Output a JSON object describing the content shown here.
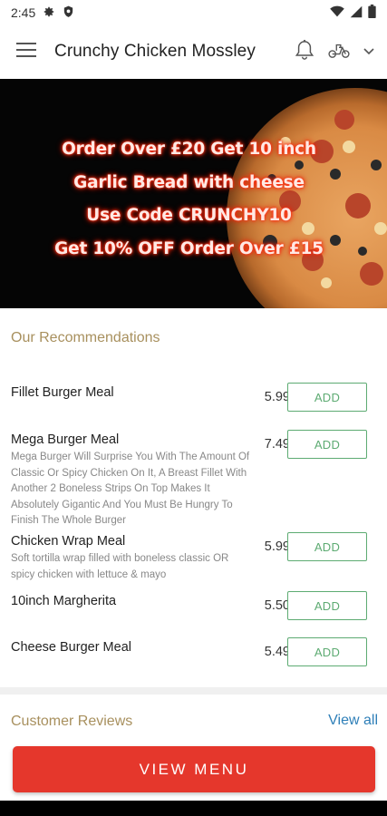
{
  "status_bar": {
    "time": "2:45"
  },
  "app_bar": {
    "title": "Crunchy Chicken Mossley"
  },
  "banner": {
    "lines": [
      "Order Over £20 Get 10 inch",
      "Garlic Bread with cheese",
      "Use Code CRUNCHY10",
      "Get 10% OFF Order Over £15"
    ]
  },
  "recommendations": {
    "title": "Our Recommendations",
    "add_label": "ADD",
    "items": [
      {
        "name": "Fillet Burger Meal",
        "description": "",
        "price": "5.99"
      },
      {
        "name": "Mega Burger Meal",
        "description": "Mega Burger Will Surprise You With The Amount Of Classic Or Spicy Chicken On It, A Breast Fillet With Another 2 Boneless Strips On Top Makes It Absolutely Gigantic And You Must Be Hungry To Finish The Whole Burger",
        "price": "7.49"
      },
      {
        "name": "Chicken Wrap Meal",
        "description": "Soft tortilla wrap filled with boneless classic OR spicy chicken with lettuce & mayo",
        "price": "5.99"
      },
      {
        "name": "10inch Margherita",
        "description": "",
        "price": "5.50"
      },
      {
        "name": "Cheese Burger Meal",
        "description": "",
        "price": "5.49"
      }
    ]
  },
  "reviews": {
    "title": "Customer Reviews",
    "view_all": "View all"
  },
  "bottom": {
    "view_menu_label": "VIEW MENU"
  },
  "colors": {
    "accent_red": "#e5372c",
    "add_green": "#5dab72",
    "section_gold": "#a8905e",
    "link_blue": "#2e7fb8",
    "banner_text_glow": "#ff3b1f"
  },
  "icons": [
    "gear-icon",
    "shield-icon",
    "wifi-icon",
    "signal-icon",
    "battery-icon",
    "hamburger-menu-icon",
    "bell-icon",
    "scooter-icon",
    "chevron-down-icon"
  ]
}
